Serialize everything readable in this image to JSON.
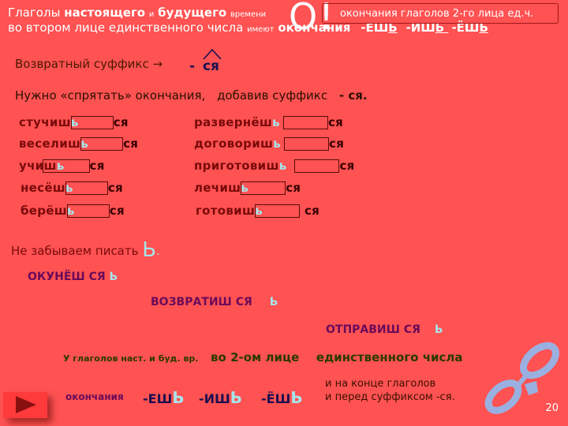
{
  "header": {
    "line1": {
      "w1": "Глаголы",
      "w2": "настоящего",
      "w3": "и",
      "w4": "будущего",
      "w5": "времени"
    },
    "line2": {
      "w1": "во втором лице единственного числа",
      "w2": "имеют",
      "w3": "окончания",
      "endings": [
        "-ЕШ",
        "Ь",
        "-ИШ",
        "Ь ",
        "-ЁШ",
        "Ь"
      ]
    },
    "exclaim": "O!",
    "callout": "окончания глаголов 2-го лица  ед.ч."
  },
  "suffix_line": {
    "label": "Возвратный суффикс →",
    "dash": "-",
    "suffix": "ся"
  },
  "hint_line": {
    "t1": "Нужно «спрятать»  окончания,",
    "t2": "добавив   суффикс",
    "t3": "- ся."
  },
  "verbs_left": [
    {
      "stem": "стучиш",
      "soft": "ь",
      "sia": "ся"
    },
    {
      "stem": "веселиш",
      "soft": "ь",
      "sia": "ся"
    },
    {
      "stem": "учиш",
      "soft": "ь",
      "sia": "ся"
    },
    {
      "stem": "несёш",
      "soft": "ь",
      "sia": "ся"
    },
    {
      "stem": "берёш",
      "soft": "ь",
      "sia": "ся"
    }
  ],
  "verbs_right": [
    {
      "stem": "развернёш",
      "soft": "ь",
      "sia": "ся"
    },
    {
      "stem": "договориш",
      "soft": "ь",
      "sia": "ся"
    },
    {
      "stem": "приготовиш",
      "soft": "ь",
      "sia": "ся"
    },
    {
      "stem": "лечиш",
      "soft": "ь",
      "sia": "ся"
    },
    {
      "stem": "готовиш",
      "soft": "ь",
      "sia": "ся"
    }
  ],
  "reminder": {
    "text": "Не забываем писать",
    "soft": "Ь",
    "dot": "."
  },
  "examples": [
    {
      "word": "ОКУНЁШ  СЯ",
      "soft": "Ь"
    },
    {
      "word": "ВОЗВРАТИШ  СЯ",
      "soft": "Ь"
    },
    {
      "word": "ОТПРАВИШ  СЯ",
      "soft": "Ь"
    }
  ],
  "rule": {
    "t1": "У глаголов  наст.  и  буд. вр.",
    "t2": "во 2-ом лице",
    "t3": "единственного числа"
  },
  "bottom": {
    "label": "окончания",
    "endings": [
      {
        "stem": "-ЕШ",
        "soft": "Ь"
      },
      {
        "stem": "-ИШ",
        "soft": "Ь"
      },
      {
        "stem": "-ЁШ",
        "soft": "Ь"
      }
    ],
    "note1": "и на конце глаголов",
    "note2": "и перед суффиксом   -ся."
  },
  "page_number": "20"
}
